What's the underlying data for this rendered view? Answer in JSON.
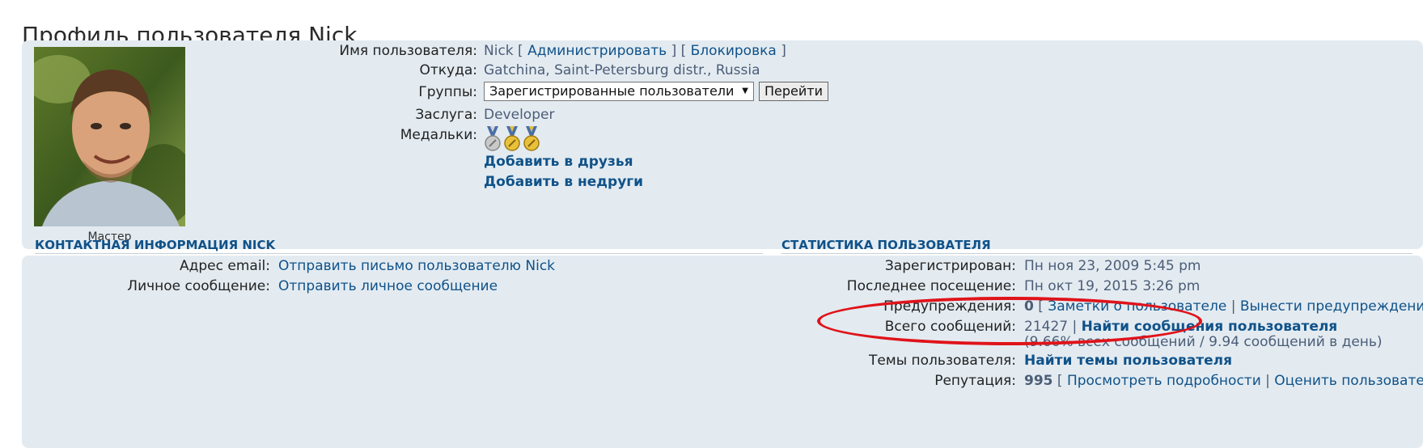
{
  "page": {
    "title": "Профиль пользователя Nick"
  },
  "profile": {
    "avatar_caption": "Мастер",
    "username_label": "Имя пользователя:",
    "username": "Nick",
    "admin_link": "Администрировать",
    "block_link": "Блокировка",
    "from_label": "Откуда:",
    "from_value": "Gatchina, Saint-Petersburg distr., Russia",
    "groups_label": "Группы:",
    "groups_selected": "Зарегистрированные пользователи",
    "go_button": "Перейти",
    "rank_label": "Заслуга:",
    "rank_value": "Developer",
    "medals_label": "Медальки:",
    "add_friend": "Добавить в друзья",
    "add_foe": "Добавить в недруги"
  },
  "contact": {
    "title": "Контактная информация Nick",
    "email_label": "Адрес email:",
    "email_link": "Отправить письмо пользователю Nick",
    "pm_label": "Личное сообщение:",
    "pm_link": "Отправить личное сообщение"
  },
  "stats": {
    "title": "Статистика пользователя",
    "registered_label": "Зарегистрирован:",
    "registered_value": "Пн ноя 23, 2009 5:45 pm",
    "last_visit_label": "Последнее посещение:",
    "last_visit_value": "Пн окт 19, 2015 3:26 pm",
    "warnings_label": "Предупреждения:",
    "warnings_count": "0",
    "notes_link": "Заметки о пользователе",
    "warn_link": "Вынести предупреждение",
    "posts_label": "Всего сообщений:",
    "posts_count": "21427",
    "find_posts_link": "Найти сообщения пользователя",
    "posts_detail": "(9.66% всех сообщений / 9.94 сообщений в день)",
    "topics_label": "Темы пользователя:",
    "find_topics_link": "Найти темы пользователя",
    "rep_label": "Репутация:",
    "rep_value": "995",
    "rep_details_link": "Просмотреть подробности",
    "rep_rate_link": "Оценить пользователя"
  },
  "colors": {
    "panel_bg": "#e3ebf1",
    "link": "#105289",
    "annotation": "#e0131a"
  },
  "icons": {
    "medals": [
      "medal-silver-icon",
      "medal-gold-icon",
      "medal-gold-icon"
    ]
  }
}
